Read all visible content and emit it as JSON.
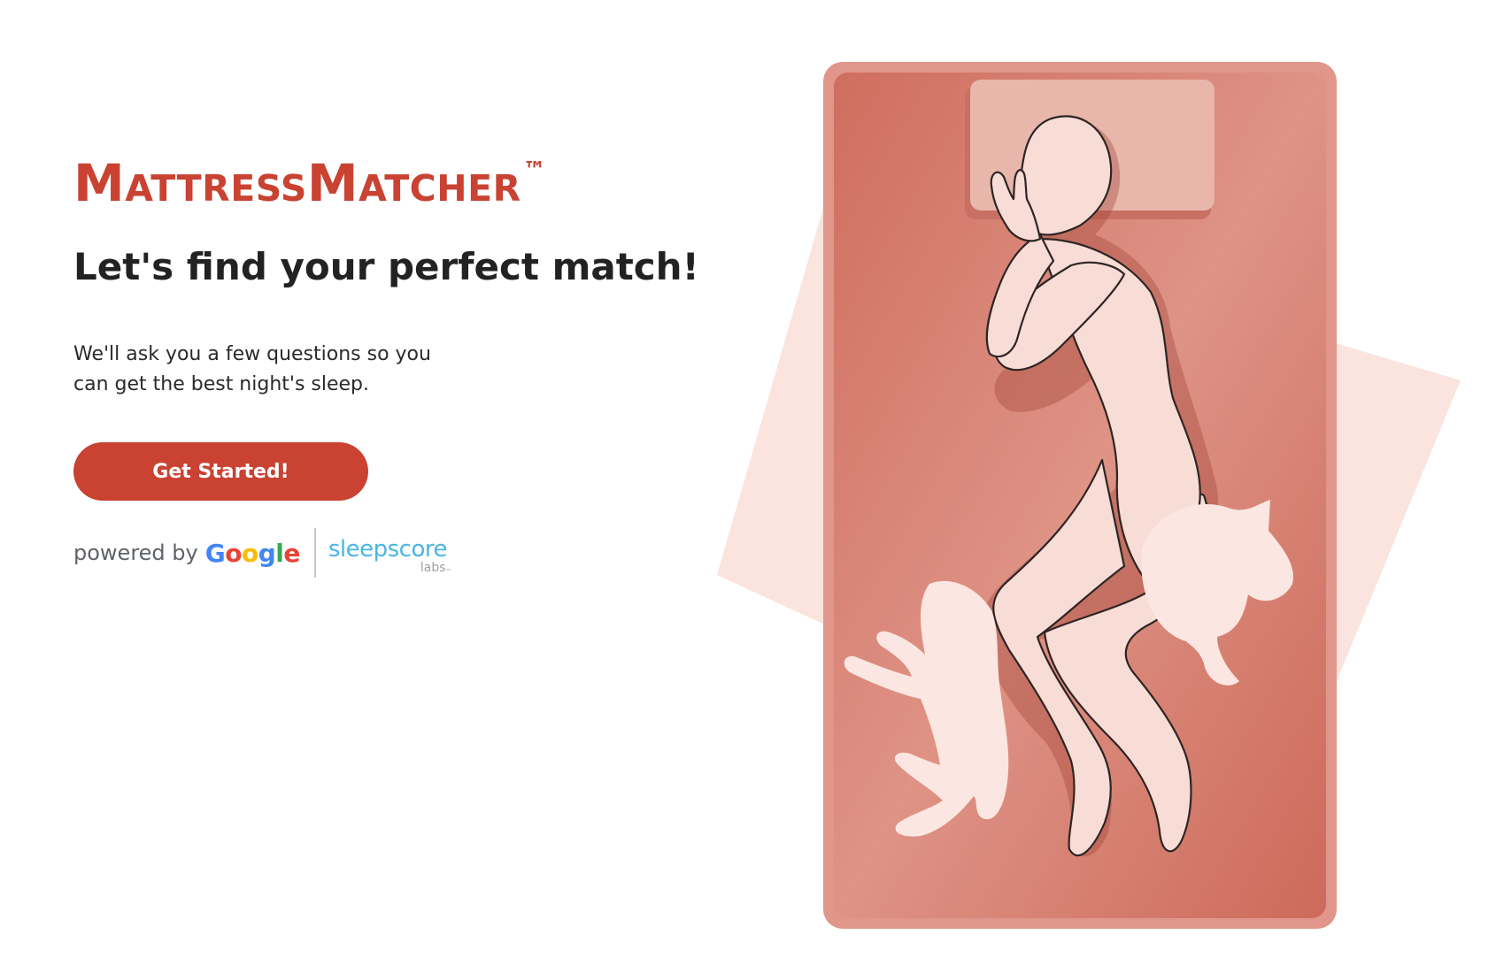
{
  "brand": {
    "name": "MattressMatcher",
    "trademark": "™",
    "color": "#c94232"
  },
  "hero": {
    "headline": "Let's find your perfect match!",
    "description": "We'll ask you a few questions so you can get the best night's sleep.",
    "cta_label": "Get Started!"
  },
  "partners": {
    "powered_by": "powered by",
    "google": {
      "letters": [
        "G",
        "o",
        "o",
        "g",
        "l",
        "e"
      ],
      "colors": [
        "#4285F4",
        "#EA4335",
        "#FBBC05",
        "#4285F4",
        "#34A853",
        "#EA4335"
      ]
    },
    "sleepscore": {
      "name": "sleepscore",
      "sub": "labs",
      "trademark": "™",
      "color": "#4ab6e3"
    }
  },
  "illustration": {
    "subject": "person sleeping on side on mattress with a cat and a dog",
    "bed_color": "#d9877a",
    "background_shape_color": "#fbe3de"
  }
}
